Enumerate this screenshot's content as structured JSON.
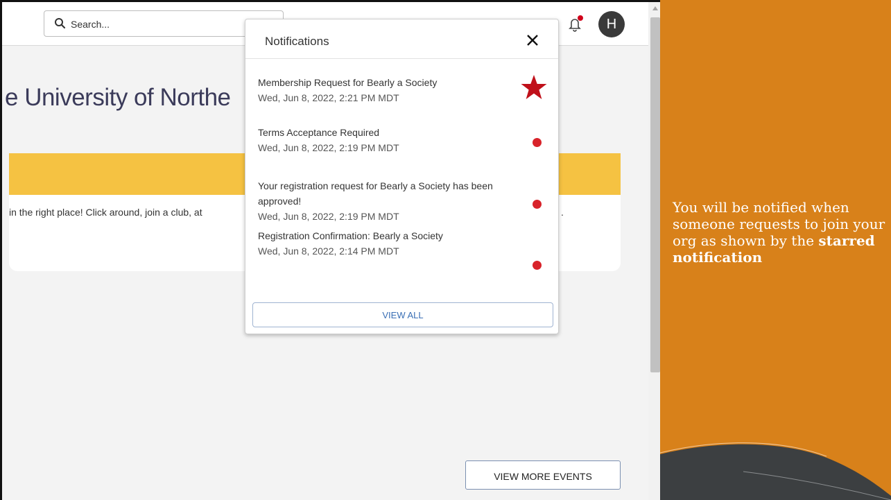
{
  "header": {
    "search_placeholder": "Search...",
    "avatar_initial": "H"
  },
  "page": {
    "heading": "e University of Northe",
    "welcome_text": "in the right place! Click around, join a club, at",
    "welcome_text_end": ".",
    "view_more_label": "VIEW MORE EVENTS"
  },
  "notifications": {
    "title": "Notifications",
    "items": [
      {
        "message": "Membership Request for Bearly a Society",
        "date": "Wed, Jun 8, 2022, 2:21 PM MDT",
        "marker": "star-icon"
      },
      {
        "message": "Terms Acceptance Required",
        "date": "Wed, Jun 8, 2022, 2:19 PM MDT",
        "marker": "unread-dot"
      },
      {
        "message": "Your registration request for Bearly a Society has been approved!",
        "date": "Wed, Jun 8, 2022, 2:19 PM MDT",
        "marker": "unread-dot"
      },
      {
        "message": "Registration Confirmation: Bearly a Society",
        "date": "Wed, Jun 8, 2022, 2:14 PM MDT",
        "marker": "unread-dot"
      }
    ],
    "view_all_label": "VIEW ALL"
  },
  "side_panel": {
    "text_before": "You will be notified when someone requests to join your org as shown by the ",
    "text_bold": "starred notification"
  },
  "colors": {
    "accent_orange": "#d8811a",
    "banner_yellow": "#f5c242",
    "unread_red": "#d8232a",
    "star_red": "#c0101a"
  }
}
